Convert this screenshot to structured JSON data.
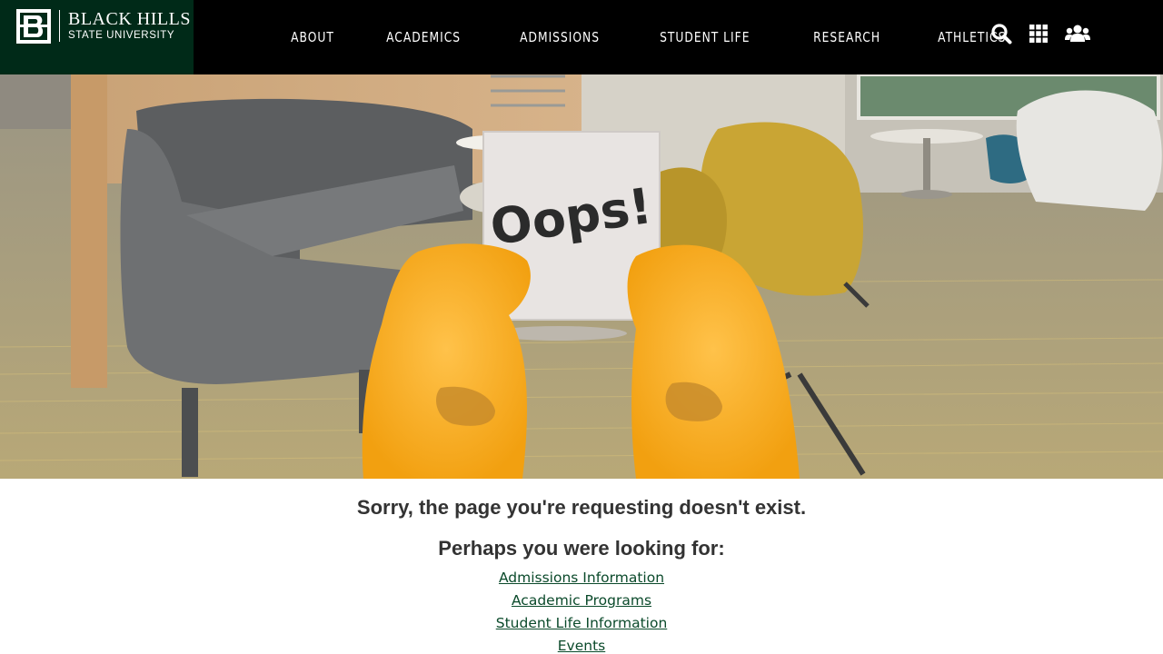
{
  "brand": {
    "name_line1": "BLACK HILLS",
    "name_line2": "STATE UNIVERSITY",
    "logo_icon": "bh-monogram-icon",
    "colors": {
      "header_bg": "#000000",
      "logo_bg": "#002a18",
      "link": "#0b4a2b",
      "text": "#333333"
    }
  },
  "nav": {
    "items": [
      {
        "label": "ABOUT"
      },
      {
        "label": "ACADEMICS"
      },
      {
        "label": "ADMISSIONS"
      },
      {
        "label": "STUDENT LIFE"
      },
      {
        "label": "RESEARCH"
      },
      {
        "label": "ATHLETICS"
      }
    ]
  },
  "tools": [
    {
      "icon": "search-icon"
    },
    {
      "icon": "grid-apps-icon"
    },
    {
      "icon": "users-group-icon"
    }
  ],
  "hero": {
    "sign_text": "Oops!"
  },
  "error": {
    "headline": "Sorry, the page you're requesting doesn't exist.",
    "subhead": "Perhaps you were looking for:",
    "links": [
      {
        "label": "Admissions Information"
      },
      {
        "label": "Academic Programs"
      },
      {
        "label": "Student Life Information"
      },
      {
        "label": "Events"
      }
    ]
  }
}
